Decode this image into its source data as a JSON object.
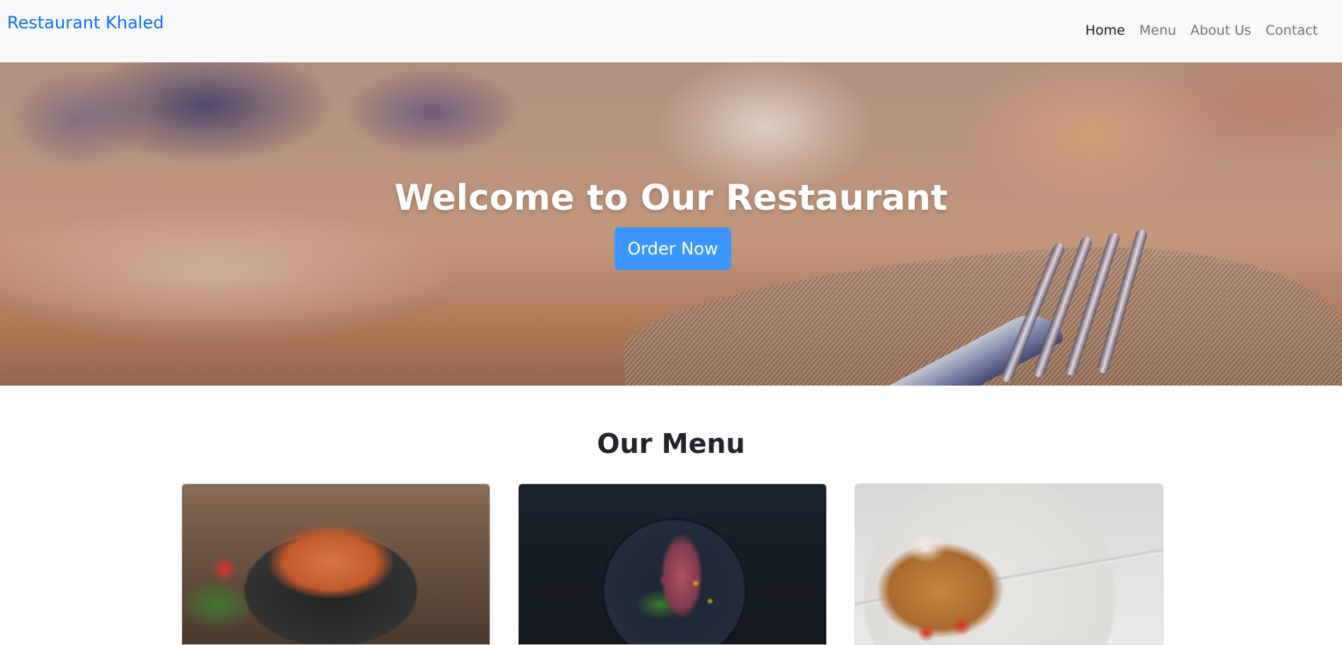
{
  "navbar": {
    "brand": "Restaurant Khaled",
    "links": [
      {
        "label": "Home",
        "active": true
      },
      {
        "label": "Menu",
        "active": false
      },
      {
        "label": "About Us",
        "active": false
      },
      {
        "label": "Contact",
        "active": false
      }
    ]
  },
  "hero": {
    "title": "Welcome to Our Restaurant",
    "button_label": "Order Now"
  },
  "menu": {
    "title": "Our Menu",
    "cards": [
      {
        "image": "grilled-salmon-salad-photo"
      },
      {
        "image": "squid-dish-dark-plate-photo"
      },
      {
        "image": "salad-bowl-with-spoon-photo"
      }
    ]
  },
  "colors": {
    "brand": "#0d6efd",
    "order_button": "#3d96ff",
    "navbar_bg": "#f8f9fa"
  }
}
